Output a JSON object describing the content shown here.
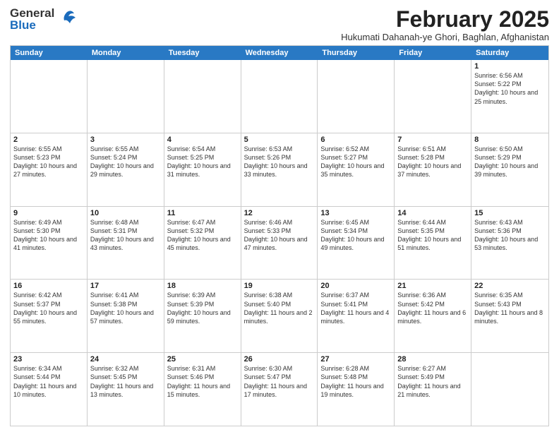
{
  "logo": {
    "line1": "General",
    "line2": "Blue"
  },
  "title": "February 2025",
  "subtitle": "Hukumati Dahanah-ye Ghori, Baghlan, Afghanistan",
  "dayHeaders": [
    "Sunday",
    "Monday",
    "Tuesday",
    "Wednesday",
    "Thursday",
    "Friday",
    "Saturday"
  ],
  "weeks": [
    {
      "days": [
        {
          "number": "",
          "info": ""
        },
        {
          "number": "",
          "info": ""
        },
        {
          "number": "",
          "info": ""
        },
        {
          "number": "",
          "info": ""
        },
        {
          "number": "",
          "info": ""
        },
        {
          "number": "",
          "info": ""
        },
        {
          "number": "1",
          "info": "Sunrise: 6:56 AM\nSunset: 5:22 PM\nDaylight: 10 hours and 25 minutes."
        }
      ]
    },
    {
      "days": [
        {
          "number": "2",
          "info": "Sunrise: 6:55 AM\nSunset: 5:23 PM\nDaylight: 10 hours and 27 minutes."
        },
        {
          "number": "3",
          "info": "Sunrise: 6:55 AM\nSunset: 5:24 PM\nDaylight: 10 hours and 29 minutes."
        },
        {
          "number": "4",
          "info": "Sunrise: 6:54 AM\nSunset: 5:25 PM\nDaylight: 10 hours and 31 minutes."
        },
        {
          "number": "5",
          "info": "Sunrise: 6:53 AM\nSunset: 5:26 PM\nDaylight: 10 hours and 33 minutes."
        },
        {
          "number": "6",
          "info": "Sunrise: 6:52 AM\nSunset: 5:27 PM\nDaylight: 10 hours and 35 minutes."
        },
        {
          "number": "7",
          "info": "Sunrise: 6:51 AM\nSunset: 5:28 PM\nDaylight: 10 hours and 37 minutes."
        },
        {
          "number": "8",
          "info": "Sunrise: 6:50 AM\nSunset: 5:29 PM\nDaylight: 10 hours and 39 minutes."
        }
      ]
    },
    {
      "days": [
        {
          "number": "9",
          "info": "Sunrise: 6:49 AM\nSunset: 5:30 PM\nDaylight: 10 hours and 41 minutes."
        },
        {
          "number": "10",
          "info": "Sunrise: 6:48 AM\nSunset: 5:31 PM\nDaylight: 10 hours and 43 minutes."
        },
        {
          "number": "11",
          "info": "Sunrise: 6:47 AM\nSunset: 5:32 PM\nDaylight: 10 hours and 45 minutes."
        },
        {
          "number": "12",
          "info": "Sunrise: 6:46 AM\nSunset: 5:33 PM\nDaylight: 10 hours and 47 minutes."
        },
        {
          "number": "13",
          "info": "Sunrise: 6:45 AM\nSunset: 5:34 PM\nDaylight: 10 hours and 49 minutes."
        },
        {
          "number": "14",
          "info": "Sunrise: 6:44 AM\nSunset: 5:35 PM\nDaylight: 10 hours and 51 minutes."
        },
        {
          "number": "15",
          "info": "Sunrise: 6:43 AM\nSunset: 5:36 PM\nDaylight: 10 hours and 53 minutes."
        }
      ]
    },
    {
      "days": [
        {
          "number": "16",
          "info": "Sunrise: 6:42 AM\nSunset: 5:37 PM\nDaylight: 10 hours and 55 minutes."
        },
        {
          "number": "17",
          "info": "Sunrise: 6:41 AM\nSunset: 5:38 PM\nDaylight: 10 hours and 57 minutes."
        },
        {
          "number": "18",
          "info": "Sunrise: 6:39 AM\nSunset: 5:39 PM\nDaylight: 10 hours and 59 minutes."
        },
        {
          "number": "19",
          "info": "Sunrise: 6:38 AM\nSunset: 5:40 PM\nDaylight: 11 hours and 2 minutes."
        },
        {
          "number": "20",
          "info": "Sunrise: 6:37 AM\nSunset: 5:41 PM\nDaylight: 11 hours and 4 minutes."
        },
        {
          "number": "21",
          "info": "Sunrise: 6:36 AM\nSunset: 5:42 PM\nDaylight: 11 hours and 6 minutes."
        },
        {
          "number": "22",
          "info": "Sunrise: 6:35 AM\nSunset: 5:43 PM\nDaylight: 11 hours and 8 minutes."
        }
      ]
    },
    {
      "days": [
        {
          "number": "23",
          "info": "Sunrise: 6:34 AM\nSunset: 5:44 PM\nDaylight: 11 hours and 10 minutes."
        },
        {
          "number": "24",
          "info": "Sunrise: 6:32 AM\nSunset: 5:45 PM\nDaylight: 11 hours and 13 minutes."
        },
        {
          "number": "25",
          "info": "Sunrise: 6:31 AM\nSunset: 5:46 PM\nDaylight: 11 hours and 15 minutes."
        },
        {
          "number": "26",
          "info": "Sunrise: 6:30 AM\nSunset: 5:47 PM\nDaylight: 11 hours and 17 minutes."
        },
        {
          "number": "27",
          "info": "Sunrise: 6:28 AM\nSunset: 5:48 PM\nDaylight: 11 hours and 19 minutes."
        },
        {
          "number": "28",
          "info": "Sunrise: 6:27 AM\nSunset: 5:49 PM\nDaylight: 11 hours and 21 minutes."
        },
        {
          "number": "",
          "info": ""
        }
      ]
    }
  ]
}
